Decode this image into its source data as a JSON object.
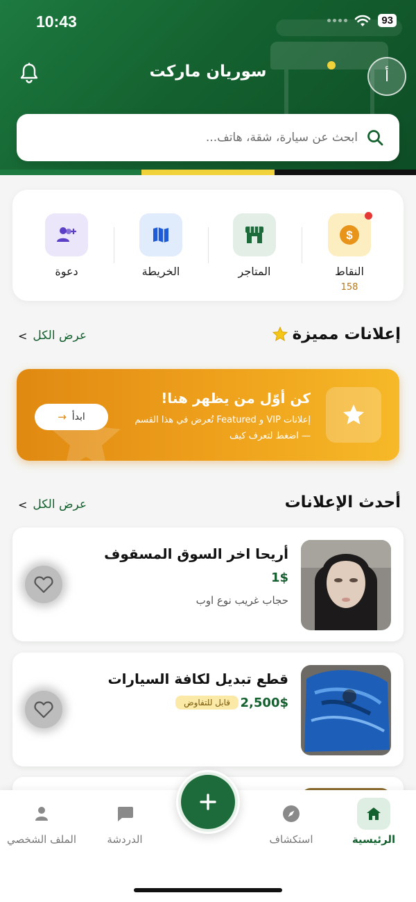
{
  "status_bar": {
    "time": "10:43",
    "battery": "93"
  },
  "header": {
    "title": "سوريان ماركت",
    "avatar_initial": "أ"
  },
  "search": {
    "placeholder": "ابحث عن سيارة، شقة، هاتف..."
  },
  "quick_actions": [
    {
      "label": "النقاط",
      "count": "158",
      "icon": "coin-icon"
    },
    {
      "label": "المتاجر",
      "icon": "store-icon"
    },
    {
      "label": "الخريطة",
      "icon": "map-icon"
    },
    {
      "label": "دعوة",
      "icon": "invite-user-icon"
    }
  ],
  "featured": {
    "title": "إعلانات مميزة",
    "see_all": "عرض الكل",
    "banner": {
      "title": "كن أوّل من يظهر هنا!",
      "line1": "إعلانات VIP و Featured تُعرض في هذا القسم",
      "line2": "— اضغط لتعرف كيف",
      "button": "ابدأ"
    }
  },
  "latest": {
    "title": "أحدث الإعلانات",
    "see_all": "عرض الكل",
    "items": [
      {
        "title": "أريحا اخر السوق المسقوف",
        "price": "1$",
        "description": "حجاب غريب نوع اوب"
      },
      {
        "title": "قطع تبديل لكافة السيارات",
        "price": "2,500$",
        "badge": "قابل للتفاوض"
      }
    ]
  },
  "bottom_nav": {
    "items": [
      {
        "label": "الرئيسية",
        "active": true
      },
      {
        "label": "استكشاف"
      },
      {
        "label": "الدردشة"
      },
      {
        "label": "الملف الشخصي"
      }
    ]
  },
  "colors": {
    "primary": "#14612f",
    "accent": "#f1d23a",
    "banner_orange": "#e08912"
  }
}
